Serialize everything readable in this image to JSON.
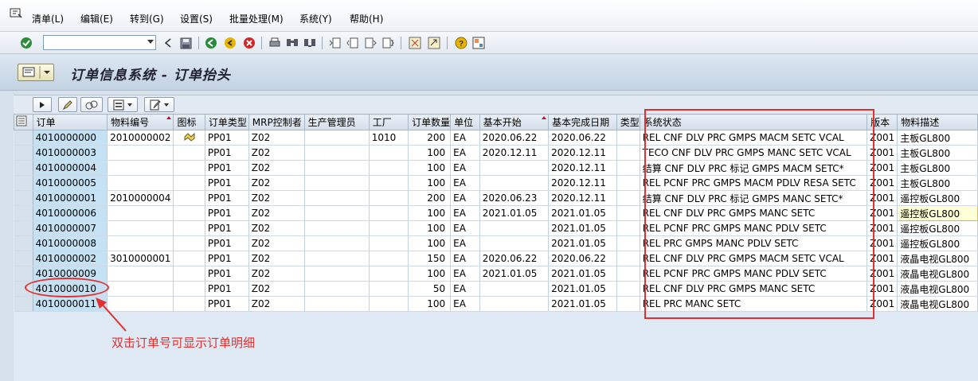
{
  "menu": {
    "items": [
      "清单(L)",
      "编辑(E)",
      "转到(G)",
      "设置(S)",
      "批量处理(M)",
      "系统(Y)",
      "帮助(H)"
    ]
  },
  "toolbar": {
    "command_value": "",
    "icons": [
      "enter-icon",
      "save-icon",
      "back-icon",
      "exit-icon",
      "cancel-icon",
      "print-icon",
      "find-icon",
      "find-next-icon",
      "first-page-icon",
      "prev-page-icon",
      "next-page-icon",
      "last-page-icon",
      "create-session-icon",
      "shortcut-icon",
      "help-icon",
      "layout-icon"
    ]
  },
  "title": "订单信息系统 - 订单抬头",
  "columns": [
    "订单",
    "物料编号",
    "图标",
    "订单类型",
    "MRP控制者",
    "生产管理员",
    "工厂",
    "订单数量",
    "单位",
    "基本开始",
    "基本完成日期",
    "类型",
    "系统状态",
    "版本",
    "物料描述"
  ],
  "rows": [
    {
      "order": "4010000000",
      "material": "2010000002",
      "icon": true,
      "type": "PP01",
      "mrp": "Z02",
      "admin": "",
      "plant": "1010",
      "qty": "200",
      "unit": "EA",
      "start": "2020.06.22",
      "finish": "2020.06.22",
      "kind": "",
      "status": "REL  CNF  DLV  PRC  GMPS MACM SETC VCAL",
      "version": "Z001",
      "desc": "主板GL800"
    },
    {
      "order": "4010000003",
      "material": "",
      "icon": false,
      "type": "PP01",
      "mrp": "Z02",
      "admin": "",
      "plant": "",
      "qty": "100",
      "unit": "EA",
      "start": "2020.12.11",
      "finish": "2020.12.11",
      "kind": "",
      "status": "TECO CNF  DLV  PRC  GMPS MANC SETC VCAL",
      "version": "Z001",
      "desc": "主板GL800"
    },
    {
      "order": "4010000004",
      "material": "",
      "icon": false,
      "type": "PP01",
      "mrp": "Z02",
      "admin": "",
      "plant": "",
      "qty": "100",
      "unit": "EA",
      "start": "",
      "finish": "2020.12.11",
      "kind": "",
      "status": "结算   CNF  DLV  PRC  标记   GMPS MACM SETC*",
      "version": "Z001",
      "desc": "主板GL800"
    },
    {
      "order": "4010000005",
      "material": "",
      "icon": false,
      "type": "PP01",
      "mrp": "Z02",
      "admin": "",
      "plant": "",
      "qty": "100",
      "unit": "EA",
      "start": "",
      "finish": "2020.12.11",
      "kind": "",
      "status": "REL  PCNF PRC  GMPS MACM PDLV RESA SETC",
      "version": "Z001",
      "desc": "主板GL800"
    },
    {
      "order": "4010000001",
      "material": "2010000004",
      "icon": false,
      "type": "PP01",
      "mrp": "Z02",
      "admin": "",
      "plant": "",
      "qty": "200",
      "unit": "EA",
      "start": "2020.06.23",
      "finish": "2020.12.11",
      "kind": "",
      "status": "结算   CNF  DLV  PRC  标记   GMPS MANC SETC*",
      "version": "Z001",
      "desc": "遥控板GL800"
    },
    {
      "order": "4010000006",
      "material": "",
      "icon": false,
      "type": "PP01",
      "mrp": "Z02",
      "admin": "",
      "plant": "",
      "qty": "100",
      "unit": "EA",
      "start": "2021.01.05",
      "finish": "2021.01.05",
      "kind": "",
      "status": "REL  CNF  DLV  PRC  GMPS MANC SETC",
      "version": "Z001",
      "desc": "遥控板GL800"
    },
    {
      "order": "4010000007",
      "material": "",
      "icon": false,
      "type": "PP01",
      "mrp": "Z02",
      "admin": "",
      "plant": "",
      "qty": "100",
      "unit": "EA",
      "start": "",
      "finish": "2021.01.05",
      "kind": "",
      "status": "REL  PCNF PRC  GMPS MANC PDLV SETC",
      "version": "Z001",
      "desc": "遥控板GL800"
    },
    {
      "order": "4010000008",
      "material": "",
      "icon": false,
      "type": "PP01",
      "mrp": "Z02",
      "admin": "",
      "plant": "",
      "qty": "100",
      "unit": "EA",
      "start": "",
      "finish": "2021.01.05",
      "kind": "",
      "status": "REL  PRC  GMPS MANC PDLV SETC",
      "version": "Z001",
      "desc": "遥控板GL800"
    },
    {
      "order": "4010000002",
      "material": "3010000001",
      "icon": false,
      "type": "PP01",
      "mrp": "Z02",
      "admin": "",
      "plant": "",
      "qty": "150",
      "unit": "EA",
      "start": "2020.06.22",
      "finish": "2020.06.22",
      "kind": "",
      "status": "REL  CNF  DLV  PRC  GMPS MACM SETC VCAL",
      "version": "Z001",
      "desc": "液晶电视GL800"
    },
    {
      "order": "4010000009",
      "material": "",
      "icon": false,
      "type": "PP01",
      "mrp": "Z02",
      "admin": "",
      "plant": "",
      "qty": "100",
      "unit": "EA",
      "start": "2021.01.05",
      "finish": "2021.01.05",
      "kind": "",
      "status": "REL  PCNF PRC  GMPS MANC PDLV SETC",
      "version": "Z001",
      "desc": "液晶电视GL800"
    },
    {
      "order": "4010000010",
      "material": "",
      "icon": false,
      "type": "PP01",
      "mrp": "Z02",
      "admin": "",
      "plant": "",
      "qty": "50",
      "unit": "EA",
      "start": "",
      "finish": "2021.01.05",
      "kind": "",
      "status": "REL  CNF  DLV  PRC  GMPS MANC SETC",
      "version": "Z001",
      "desc": "液晶电视GL800"
    },
    {
      "order": "4010000011",
      "material": "",
      "icon": false,
      "type": "PP01",
      "mrp": "Z02",
      "admin": "",
      "plant": "",
      "qty": "100",
      "unit": "EA",
      "start": "",
      "finish": "2021.01.05",
      "kind": "",
      "status": "REL  PRC  MANC SETC",
      "version": "Z001",
      "desc": "液晶电视GL800"
    }
  ],
  "highlighted_cell": {
    "row": 5,
    "column": "物料描述"
  },
  "annotation": "双击订单号可显示订单明细",
  "colors": {
    "annotation": "#e03030",
    "key_column": "#c4e2f3",
    "background": "#d7e1ec"
  }
}
